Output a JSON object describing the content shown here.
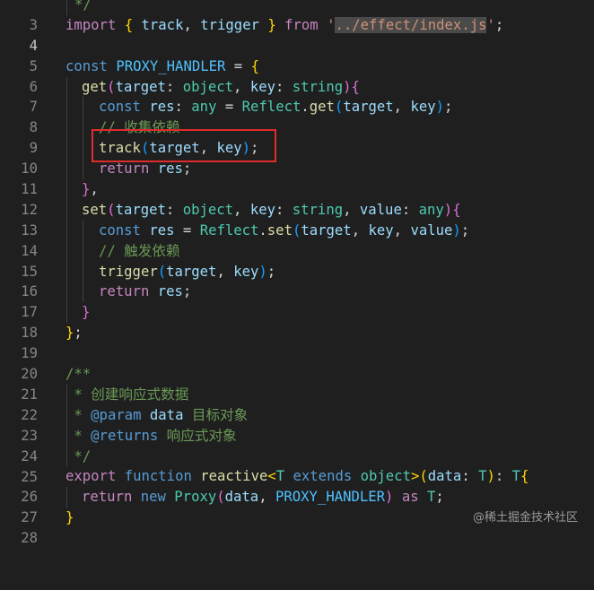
{
  "editor": {
    "line_numbers": [
      "3",
      "4",
      "5",
      "6",
      "7",
      "8",
      "9",
      "10",
      "11",
      "12",
      "13",
      "14",
      "15",
      "16",
      "17",
      "18",
      "19",
      "20",
      "21",
      "22",
      "23",
      "24",
      "25",
      "26",
      "27",
      "28"
    ],
    "code": {
      "l3": {
        "t1": "*/"
      },
      "l4": {
        "t1": "import",
        "t2": " ",
        "t3": "{",
        "t4": " ",
        "t5": "track",
        "t6": ", ",
        "t7": "trigger",
        "t8": " ",
        "t9": "}",
        "t10": " ",
        "t11": "from",
        "t12": " ",
        "t13": "'",
        "t14": "../effect/index.js",
        "t15": "'",
        "t16": ";"
      },
      "l5": {},
      "l6": {
        "t1": "const",
        "t2": " ",
        "t3": "PROXY_HANDLER",
        "t4": " = ",
        "t5": "{"
      },
      "l7": {
        "t1": "get",
        "t2": "(",
        "t3": "target",
        "t4": ": ",
        "t5": "object",
        "t6": ", ",
        "t7": "key",
        "t8": ": ",
        "t9": "string",
        "t10": ")",
        "t11": "{"
      },
      "l8": {
        "t1": "const",
        "t2": " ",
        "t3": "res",
        "t4": ": ",
        "t5": "any",
        "t6": " = ",
        "t7": "Reflect",
        "t8": ".",
        "t9": "get",
        "t10": "(",
        "t11": "target",
        "t12": ", ",
        "t13": "key",
        "t14": ")",
        "t15": ";"
      },
      "l9": {
        "t1": "// 收集依赖"
      },
      "l10": {
        "t1": "track",
        "t2": "(",
        "t3": "target",
        "t4": ", ",
        "t5": "key",
        "t6": ")",
        "t7": ";"
      },
      "l11": {
        "t1": "return",
        "t2": " ",
        "t3": "res",
        "t4": ";"
      },
      "l12": {
        "t1": "}",
        "t2": ","
      },
      "l13": {
        "t1": "set",
        "t2": "(",
        "t3": "target",
        "t4": ": ",
        "t5": "object",
        "t6": ", ",
        "t7": "key",
        "t8": ": ",
        "t9": "string",
        "t10": ", ",
        "t11": "value",
        "t12": ": ",
        "t13": "any",
        "t14": ")",
        "t15": "{"
      },
      "l14": {
        "t1": "const",
        "t2": " ",
        "t3": "res",
        "t4": " = ",
        "t5": "Reflect",
        "t6": ".",
        "t7": "set",
        "t8": "(",
        "t9": "target",
        "t10": ", ",
        "t11": "key",
        "t12": ", ",
        "t13": "value",
        "t14": ")",
        "t15": ";"
      },
      "l15": {
        "t1": "// 触发依赖"
      },
      "l16": {
        "t1": "trigger",
        "t2": "(",
        "t3": "target",
        "t4": ", ",
        "t5": "key",
        "t6": ")",
        "t7": ";"
      },
      "l17": {
        "t1": "return",
        "t2": " ",
        "t3": "res",
        "t4": ";"
      },
      "l18": {
        "t1": "}"
      },
      "l19": {
        "t1": "}",
        "t2": ";"
      },
      "l20": {},
      "l21": {
        "t1": "/**"
      },
      "l22": {
        "t1": " * 创建响应式数据"
      },
      "l23": {
        "t1": " * ",
        "t2": "@param",
        "t3": " ",
        "t4": "data",
        "t5": " 目标对象"
      },
      "l24": {
        "t1": " * ",
        "t2": "@returns",
        "t3": " 响应式对象"
      },
      "l25": {
        "t1": " */"
      },
      "l26": {
        "t1": "export",
        "t2": " ",
        "t3": "function",
        "t4": " ",
        "t5": "reactive",
        "t6": "<",
        "t7": "T",
        "t8": " ",
        "t9": "extends",
        "t10": " ",
        "t11": "object",
        "t12": ">",
        "t13": "(",
        "t14": "data",
        "t15": ": ",
        "t16": "T",
        "t17": ")",
        "t18": ": ",
        "t19": "T",
        "t20": "{"
      },
      "l27": {
        "t1": "return",
        "t2": " ",
        "t3": "new",
        "t4": " ",
        "t5": "Proxy",
        "t6": "(",
        "t7": "data",
        "t8": ", ",
        "t9": "PROXY_HANDLER",
        "t10": ")",
        "t11": " ",
        "t12": "as",
        "t13": " ",
        "t14": "T",
        "t15": ";"
      },
      "l28": {
        "t1": "}"
      }
    }
  },
  "watermark": "@稀土掘金技术社区",
  "colors": {
    "background": "#1f1f1f",
    "highlight_box": "#e02b2b",
    "keyword": "#569cd6",
    "control_keyword": "#c586c0",
    "function": "#dcdcaa",
    "variable": "#9cdcfe",
    "type": "#4ec9b0",
    "string": "#ce9178",
    "comment": "#6a9955"
  }
}
